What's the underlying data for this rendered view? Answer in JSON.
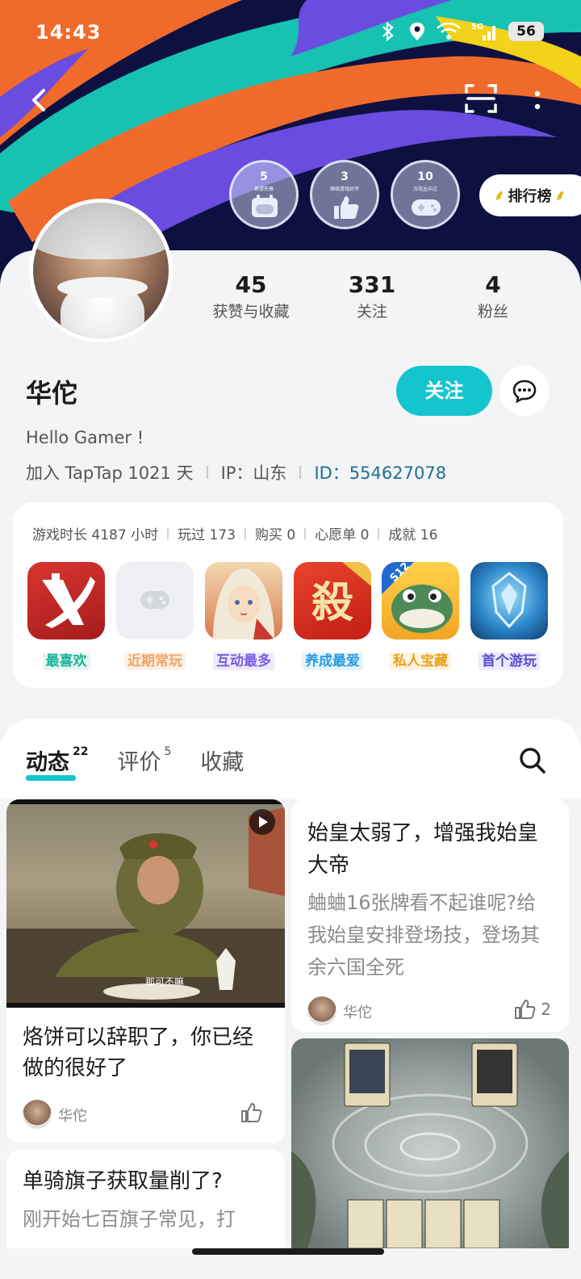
{
  "status": {
    "time": "14:43",
    "network": "5G",
    "battery": "56"
  },
  "nav": {
    "back": "back",
    "scan": "scan",
    "more": "more"
  },
  "badges": [
    {
      "num": "5",
      "sub": "新游先锋",
      "icon": "calendar-controller-icon"
    },
    {
      "num": "3",
      "sub": "继续游戏好评",
      "icon": "thumbs-up-icon"
    },
    {
      "num": "10",
      "sub": "万花丛中过",
      "icon": "gamepad-icon"
    }
  ],
  "rank": {
    "label": "排行榜"
  },
  "profile": {
    "name": "华佗",
    "bio": "Hello Gamer !",
    "join": "加入 TapTap 1021 天",
    "ip": "IP：山东",
    "id": "ID：554627078",
    "follow_label": "关注"
  },
  "stats": [
    {
      "n": "45",
      "l": "获赞与收藏"
    },
    {
      "n": "331",
      "l": "关注"
    },
    {
      "n": "4",
      "l": "粉丝"
    }
  ],
  "game_stats": [
    "游戏时长 4187 小时",
    "玩过 173",
    "购买 0",
    "心愿单 0",
    "成就 16"
  ],
  "games": [
    {
      "tag": "最喜欢",
      "color": "#19b39a",
      "bg": "#e6f7f3"
    },
    {
      "tag": "近期常玩",
      "color": "#f0a46a",
      "bg": "#fdf1e7"
    },
    {
      "tag": "互动最多",
      "color": "#7b5ce0",
      "bg": "#efeafc"
    },
    {
      "tag": "养成最爱",
      "color": "#2a9de0",
      "bg": "#e5f3fc"
    },
    {
      "tag": "私人宝藏",
      "color": "#e8a11a",
      "bg": "#fdf3e0"
    },
    {
      "tag": "首个游玩",
      "color": "#5a4bcf",
      "bg": "#ecebfb"
    }
  ],
  "tabs": [
    {
      "label": "动态",
      "count": "22"
    },
    {
      "label": "评价",
      "count": "5"
    },
    {
      "label": "收藏",
      "count": ""
    }
  ],
  "posts": [
    {
      "title": "烙饼可以辞职了，你已经做的很好了",
      "author": "华佗",
      "likes": "",
      "subtitle_text": "那可不嘛"
    },
    {
      "title": "始皇太弱了，增强我始皇大帝",
      "body": "蛐蛐16张牌看不起谁呢?给我始皇安排登场技，登场其余六国全死",
      "author": "华佗",
      "likes": "2"
    },
    {
      "title": "单骑旗子获取量削了?",
      "body": "刚开始七百旗子常见，打"
    }
  ]
}
